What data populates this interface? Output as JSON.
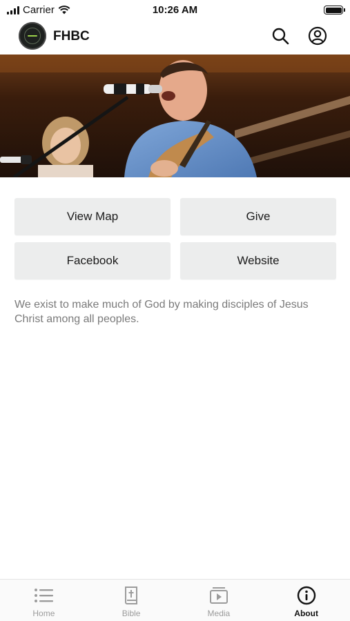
{
  "status_bar": {
    "carrier": "Carrier",
    "time": "10:26 AM"
  },
  "header": {
    "title": "FHBC"
  },
  "actions": [
    {
      "label": "View Map"
    },
    {
      "label": "Give"
    },
    {
      "label": "Facebook"
    },
    {
      "label": "Website"
    }
  ],
  "mission": "We exist to make much of God by making disciples of Jesus Christ among all peoples.",
  "tabs": [
    {
      "label": "Home",
      "icon": "list-icon"
    },
    {
      "label": "Bible",
      "icon": "bible-icon"
    },
    {
      "label": "Media",
      "icon": "media-icon"
    },
    {
      "label": "About",
      "icon": "info-icon",
      "active": true
    }
  ],
  "colors": {
    "active_tab": "#111111",
    "inactive_tab": "#9b9b9b",
    "button_bg": "#eceded",
    "mission_text": "#7a7a7a"
  }
}
